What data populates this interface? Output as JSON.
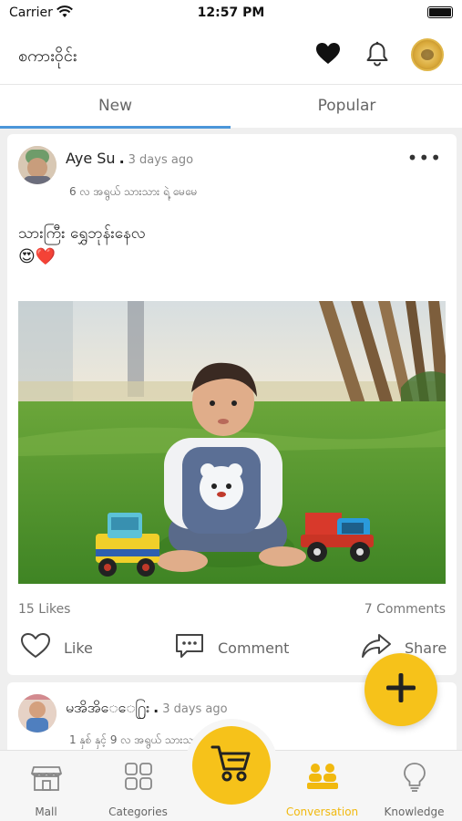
{
  "status_bar": {
    "carrier": "Carrier",
    "time": "12:57 PM"
  },
  "header": {
    "title": "စကားဝိုင်း",
    "icons": [
      "heart-icon",
      "bell-icon",
      "avatar"
    ]
  },
  "tabs": [
    {
      "label": "New",
      "active": true
    },
    {
      "label": "Popular",
      "active": false
    }
  ],
  "accent_color": "#f6c21a",
  "tab_indicator_color": "#4b96d9",
  "posts": [
    {
      "author": "Aye Su",
      "time": "3 days ago",
      "meta": "6 လ အရွယ် သားသား ရဲ့ မေမေ",
      "text": "သားကြီး ရွှေဘုန်းနေလ",
      "emoji": "😍❤️",
      "likes": "15 Likes",
      "comments": "7 Comments",
      "actions": {
        "like": "Like",
        "comment": "Comment",
        "share": "Share"
      }
    },
    {
      "author": "မအိအိ‌ေ‌ေ႐ြး",
      "time": "3 days ago",
      "meta": "1 နှစ် နှင့် 9 လ အရွယ် သားသား ရဲ့ မေမေ"
    }
  ],
  "bottom_nav": [
    {
      "label": "Mall",
      "icon": "shop-icon"
    },
    {
      "label": "Categories",
      "icon": "grid-icon"
    },
    {
      "label": "",
      "icon": "cart-icon"
    },
    {
      "label": "Conversation",
      "icon": "people-icon",
      "active": true
    },
    {
      "label": "Knowledge",
      "icon": "lightbulb-icon"
    }
  ]
}
